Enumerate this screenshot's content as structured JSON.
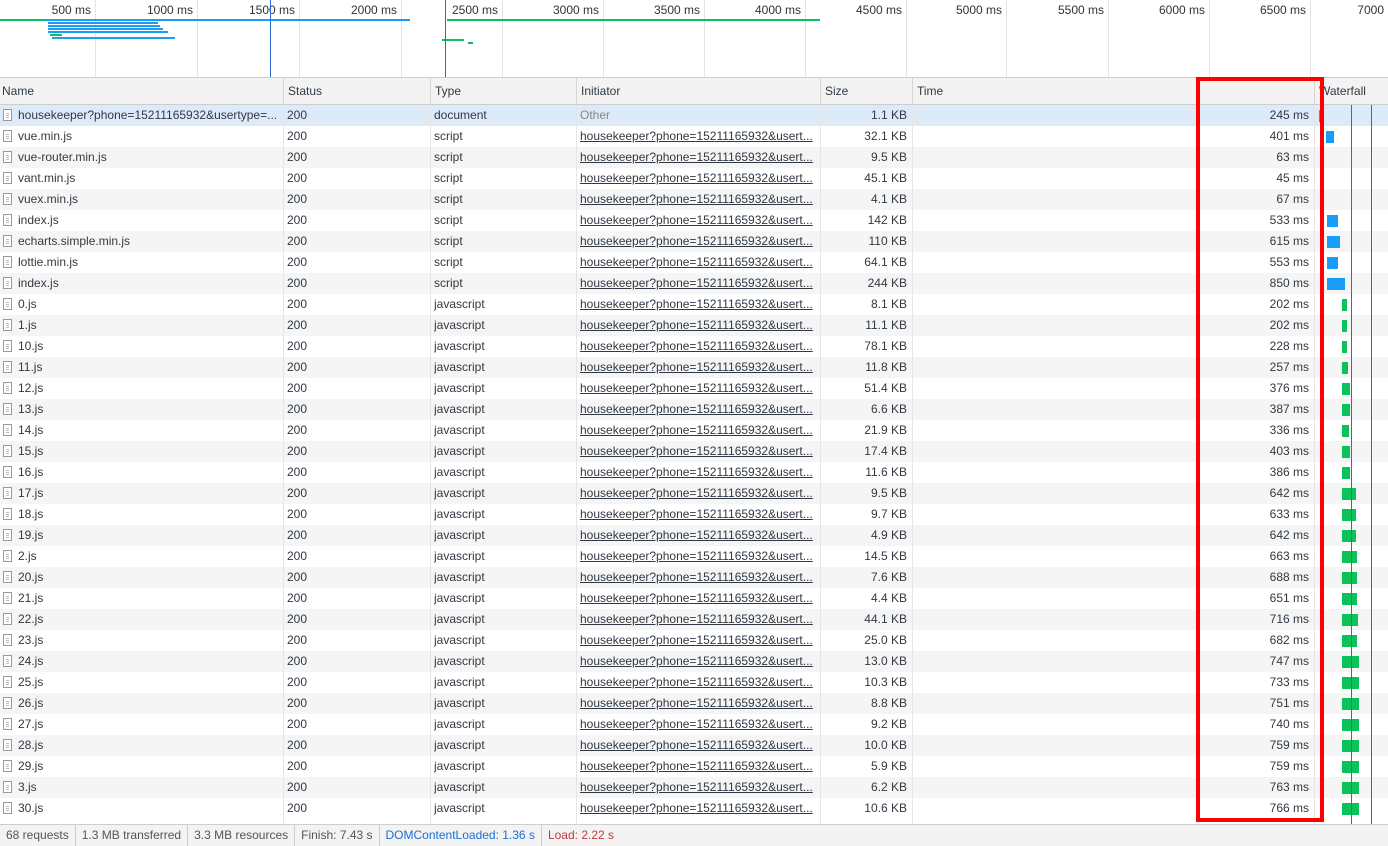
{
  "overview": {
    "ticks": [
      "500 ms",
      "1000 ms",
      "1500 ms",
      "2000 ms",
      "2500 ms",
      "3000 ms",
      "3500 ms",
      "4000 ms",
      "4500 ms",
      "5000 ms",
      "5500 ms",
      "6000 ms",
      "6500 ms",
      "7000"
    ]
  },
  "columns": {
    "name": "Name",
    "status": "Status",
    "type": "Type",
    "initiator": "Initiator",
    "size": "Size",
    "time": "Time",
    "waterfall": "Waterfall"
  },
  "rows": [
    {
      "name": "housekeeper?phone=15211165932&usertype=...",
      "status": "200",
      "type": "document",
      "initiator": "Other",
      "size": "1.1 KB",
      "time": "245 ms"
    },
    {
      "name": "vue.min.js",
      "status": "200",
      "type": "script",
      "initiator": "housekeeper?phone=15211165932&usert...",
      "size": "32.1 KB",
      "time": "401 ms"
    },
    {
      "name": "vue-router.min.js",
      "status": "200",
      "type": "script",
      "initiator": "housekeeper?phone=15211165932&usert...",
      "size": "9.5 KB",
      "time": "63 ms"
    },
    {
      "name": "vant.min.js",
      "status": "200",
      "type": "script",
      "initiator": "housekeeper?phone=15211165932&usert...",
      "size": "45.1 KB",
      "time": "45 ms"
    },
    {
      "name": "vuex.min.js",
      "status": "200",
      "type": "script",
      "initiator": "housekeeper?phone=15211165932&usert...",
      "size": "4.1 KB",
      "time": "67 ms"
    },
    {
      "name": "index.js",
      "status": "200",
      "type": "script",
      "initiator": "housekeeper?phone=15211165932&usert...",
      "size": "142 KB",
      "time": "533 ms"
    },
    {
      "name": "echarts.simple.min.js",
      "status": "200",
      "type": "script",
      "initiator": "housekeeper?phone=15211165932&usert...",
      "size": "110 KB",
      "time": "615 ms"
    },
    {
      "name": "lottie.min.js",
      "status": "200",
      "type": "script",
      "initiator": "housekeeper?phone=15211165932&usert...",
      "size": "64.1 KB",
      "time": "553 ms"
    },
    {
      "name": "index.js",
      "status": "200",
      "type": "script",
      "initiator": "housekeeper?phone=15211165932&usert...",
      "size": "244 KB",
      "time": "850 ms"
    },
    {
      "name": "0.js",
      "status": "200",
      "type": "javascript",
      "initiator": "housekeeper?phone=15211165932&usert...",
      "size": "8.1 KB",
      "time": "202 ms"
    },
    {
      "name": "1.js",
      "status": "200",
      "type": "javascript",
      "initiator": "housekeeper?phone=15211165932&usert...",
      "size": "11.1 KB",
      "time": "202 ms"
    },
    {
      "name": "10.js",
      "status": "200",
      "type": "javascript",
      "initiator": "housekeeper?phone=15211165932&usert...",
      "size": "78.1 KB",
      "time": "228 ms"
    },
    {
      "name": "11.js",
      "status": "200",
      "type": "javascript",
      "initiator": "housekeeper?phone=15211165932&usert...",
      "size": "11.8 KB",
      "time": "257 ms"
    },
    {
      "name": "12.js",
      "status": "200",
      "type": "javascript",
      "initiator": "housekeeper?phone=15211165932&usert...",
      "size": "51.4 KB",
      "time": "376 ms"
    },
    {
      "name": "13.js",
      "status": "200",
      "type": "javascript",
      "initiator": "housekeeper?phone=15211165932&usert...",
      "size": "6.6 KB",
      "time": "387 ms"
    },
    {
      "name": "14.js",
      "status": "200",
      "type": "javascript",
      "initiator": "housekeeper?phone=15211165932&usert...",
      "size": "21.9 KB",
      "time": "336 ms"
    },
    {
      "name": "15.js",
      "status": "200",
      "type": "javascript",
      "initiator": "housekeeper?phone=15211165932&usert...",
      "size": "17.4 KB",
      "time": "403 ms"
    },
    {
      "name": "16.js",
      "status": "200",
      "type": "javascript",
      "initiator": "housekeeper?phone=15211165932&usert...",
      "size": "11.6 KB",
      "time": "386 ms"
    },
    {
      "name": "17.js",
      "status": "200",
      "type": "javascript",
      "initiator": "housekeeper?phone=15211165932&usert...",
      "size": "9.5 KB",
      "time": "642 ms"
    },
    {
      "name": "18.js",
      "status": "200",
      "type": "javascript",
      "initiator": "housekeeper?phone=15211165932&usert...",
      "size": "9.7 KB",
      "time": "633 ms"
    },
    {
      "name": "19.js",
      "status": "200",
      "type": "javascript",
      "initiator": "housekeeper?phone=15211165932&usert...",
      "size": "4.9 KB",
      "time": "642 ms"
    },
    {
      "name": "2.js",
      "status": "200",
      "type": "javascript",
      "initiator": "housekeeper?phone=15211165932&usert...",
      "size": "14.5 KB",
      "time": "663 ms"
    },
    {
      "name": "20.js",
      "status": "200",
      "type": "javascript",
      "initiator": "housekeeper?phone=15211165932&usert...",
      "size": "7.6 KB",
      "time": "688 ms"
    },
    {
      "name": "21.js",
      "status": "200",
      "type": "javascript",
      "initiator": "housekeeper?phone=15211165932&usert...",
      "size": "4.4 KB",
      "time": "651 ms"
    },
    {
      "name": "22.js",
      "status": "200",
      "type": "javascript",
      "initiator": "housekeeper?phone=15211165932&usert...",
      "size": "44.1 KB",
      "time": "716 ms"
    },
    {
      "name": "23.js",
      "status": "200",
      "type": "javascript",
      "initiator": "housekeeper?phone=15211165932&usert...",
      "size": "25.0 KB",
      "time": "682 ms"
    },
    {
      "name": "24.js",
      "status": "200",
      "type": "javascript",
      "initiator": "housekeeper?phone=15211165932&usert...",
      "size": "13.0 KB",
      "time": "747 ms"
    },
    {
      "name": "25.js",
      "status": "200",
      "type": "javascript",
      "initiator": "housekeeper?phone=15211165932&usert...",
      "size": "10.3 KB",
      "time": "733 ms"
    },
    {
      "name": "26.js",
      "status": "200",
      "type": "javascript",
      "initiator": "housekeeper?phone=15211165932&usert...",
      "size": "8.8 KB",
      "time": "751 ms"
    },
    {
      "name": "27.js",
      "status": "200",
      "type": "javascript",
      "initiator": "housekeeper?phone=15211165932&usert...",
      "size": "9.2 KB",
      "time": "740 ms"
    },
    {
      "name": "28.js",
      "status": "200",
      "type": "javascript",
      "initiator": "housekeeper?phone=15211165932&usert...",
      "size": "10.0 KB",
      "time": "759 ms"
    },
    {
      "name": "29.js",
      "status": "200",
      "type": "javascript",
      "initiator": "housekeeper?phone=15211165932&usert...",
      "size": "5.9 KB",
      "time": "759 ms"
    },
    {
      "name": "3.js",
      "status": "200",
      "type": "javascript",
      "initiator": "housekeeper?phone=15211165932&usert...",
      "size": "6.2 KB",
      "time": "763 ms"
    },
    {
      "name": "30.js",
      "status": "200",
      "type": "javascript",
      "initiator": "housekeeper?phone=15211165932&usert...",
      "size": "10.6 KB",
      "time": "766 ms"
    }
  ],
  "footer": {
    "requests": "68 requests",
    "transferred": "1.3 MB transferred",
    "resources": "3.3 MB resources",
    "finish": "Finish: 7.43 s",
    "dcl": "DOMContentLoaded: 1.36 s",
    "load": "Load: 2.22 s"
  },
  "colors": {
    "blue_bar": "#1a9df6",
    "green_bar": "#0cc25a",
    "dcl_line": "#2a6bd4",
    "load_line": "#c23b3b",
    "highlight": "#ff0000",
    "selected_row": "#ddeaf8"
  },
  "icons": {
    "file": "file-icon"
  }
}
